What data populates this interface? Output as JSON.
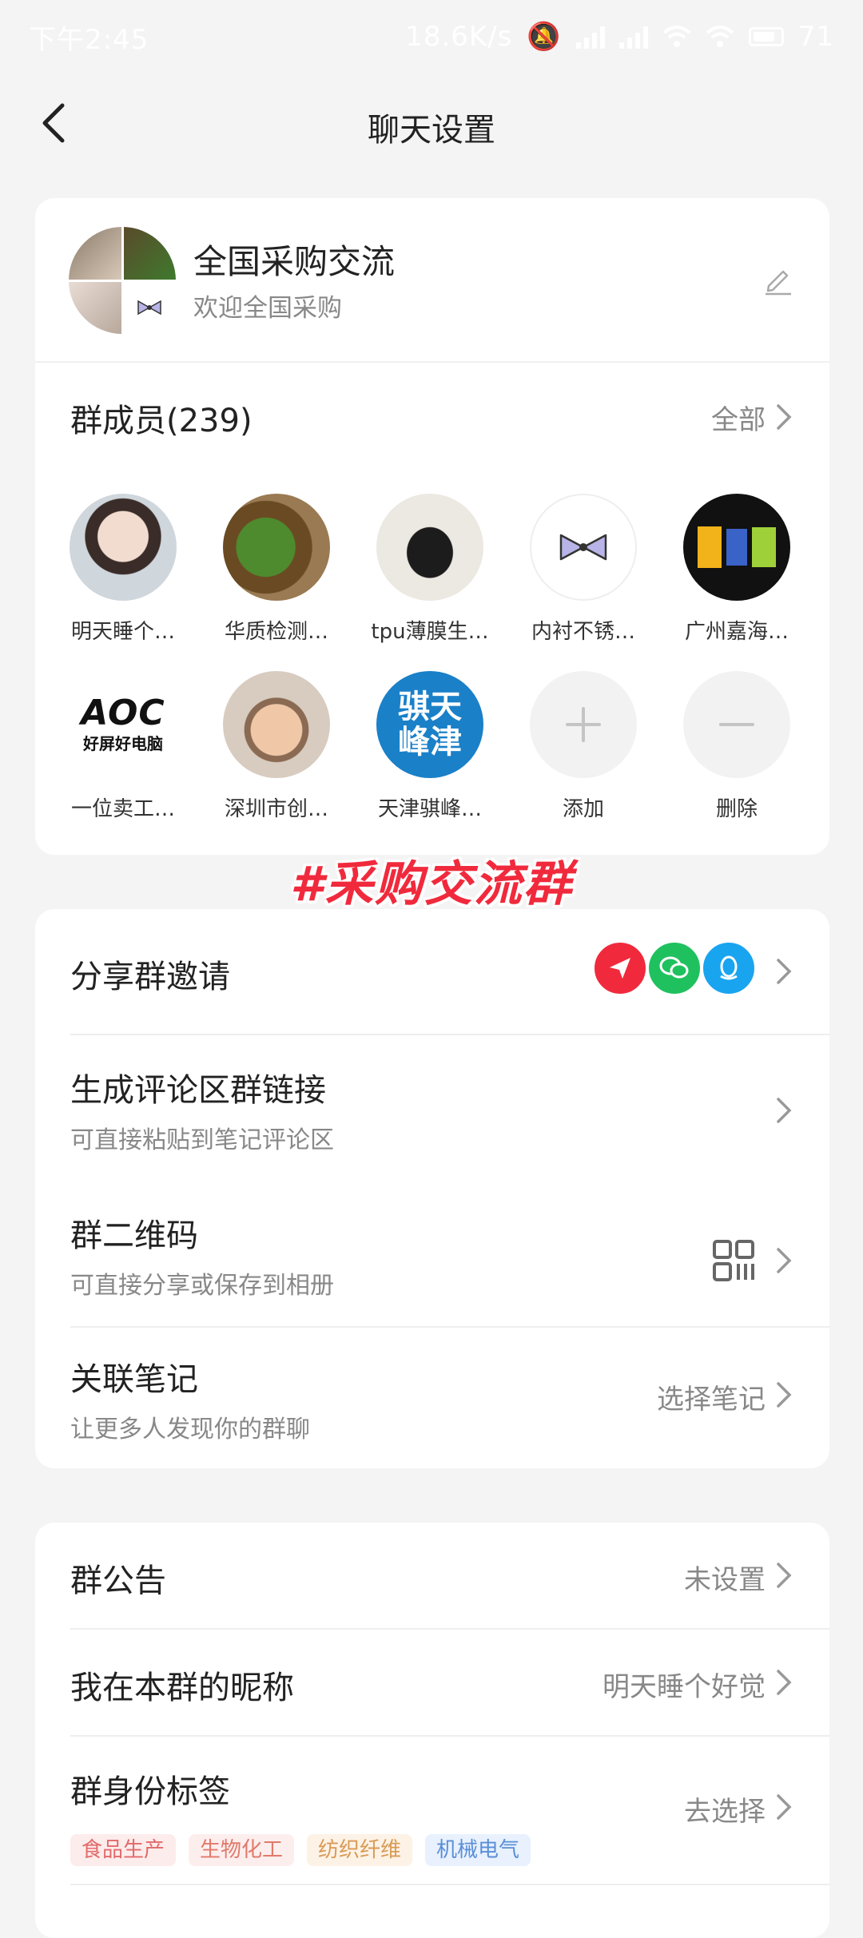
{
  "status_bar": {
    "time": "下午2:45",
    "speed": "18.6K/s",
    "battery": "71"
  },
  "header": {
    "title": "聊天设置"
  },
  "group": {
    "name": "全国采购交流",
    "description": "欢迎全国采购"
  },
  "members": {
    "title": "群成员(239)",
    "all_label": "全部",
    "list": [
      {
        "name": "明天睡个…"
      },
      {
        "name": "华质检测…"
      },
      {
        "name": "tpu薄膜生…"
      },
      {
        "name": "内衬不锈…"
      },
      {
        "name": "广州嘉海…"
      },
      {
        "name": "一位卖工…"
      },
      {
        "name": "深圳市创…"
      },
      {
        "name": "天津骐峰…"
      }
    ],
    "add_label": "添加",
    "remove_label": "删除",
    "aoc_logo": "AOC",
    "aoc_slogan": "好屏好电脑",
    "tianjin_logo": "骐天峰津"
  },
  "overlay_tag": "#采购交流群",
  "settings": {
    "share_invite": "分享群邀请",
    "comment_link": {
      "title": "生成评论区群链接",
      "subtitle": "可直接粘贴到笔记评论区"
    },
    "qr_code": {
      "title": "群二维码",
      "subtitle": "可直接分享或保存到相册"
    },
    "linked_note": {
      "title": "关联笔记",
      "subtitle": "让更多人发现你的群聊",
      "value": "选择笔记"
    }
  },
  "settings2": {
    "announcement": {
      "title": "群公告",
      "value": "未设置"
    },
    "nickname": {
      "title": "我在本群的昵称",
      "value": "明天睡个好觉"
    },
    "identity_tags": {
      "title": "群身份标签",
      "value": "去选择",
      "chips": [
        "食品生产",
        "生物化工",
        "纺织纤维",
        "机械电气"
      ]
    }
  },
  "colors": {
    "accent_red": "#f02a3c",
    "wechat_green": "#1fc15e",
    "qq_blue": "#19a4f0",
    "chip_red_bg": "#fdecec",
    "chip_red": "#e26a6a",
    "chip_pink_bg": "#fdeeee",
    "chip_pink": "#e07a6a",
    "chip_orange_bg": "#fdf2e6",
    "chip_orange": "#d99a55",
    "chip_blue_bg": "#e8f1fd",
    "chip_blue": "#5a8fd8"
  }
}
